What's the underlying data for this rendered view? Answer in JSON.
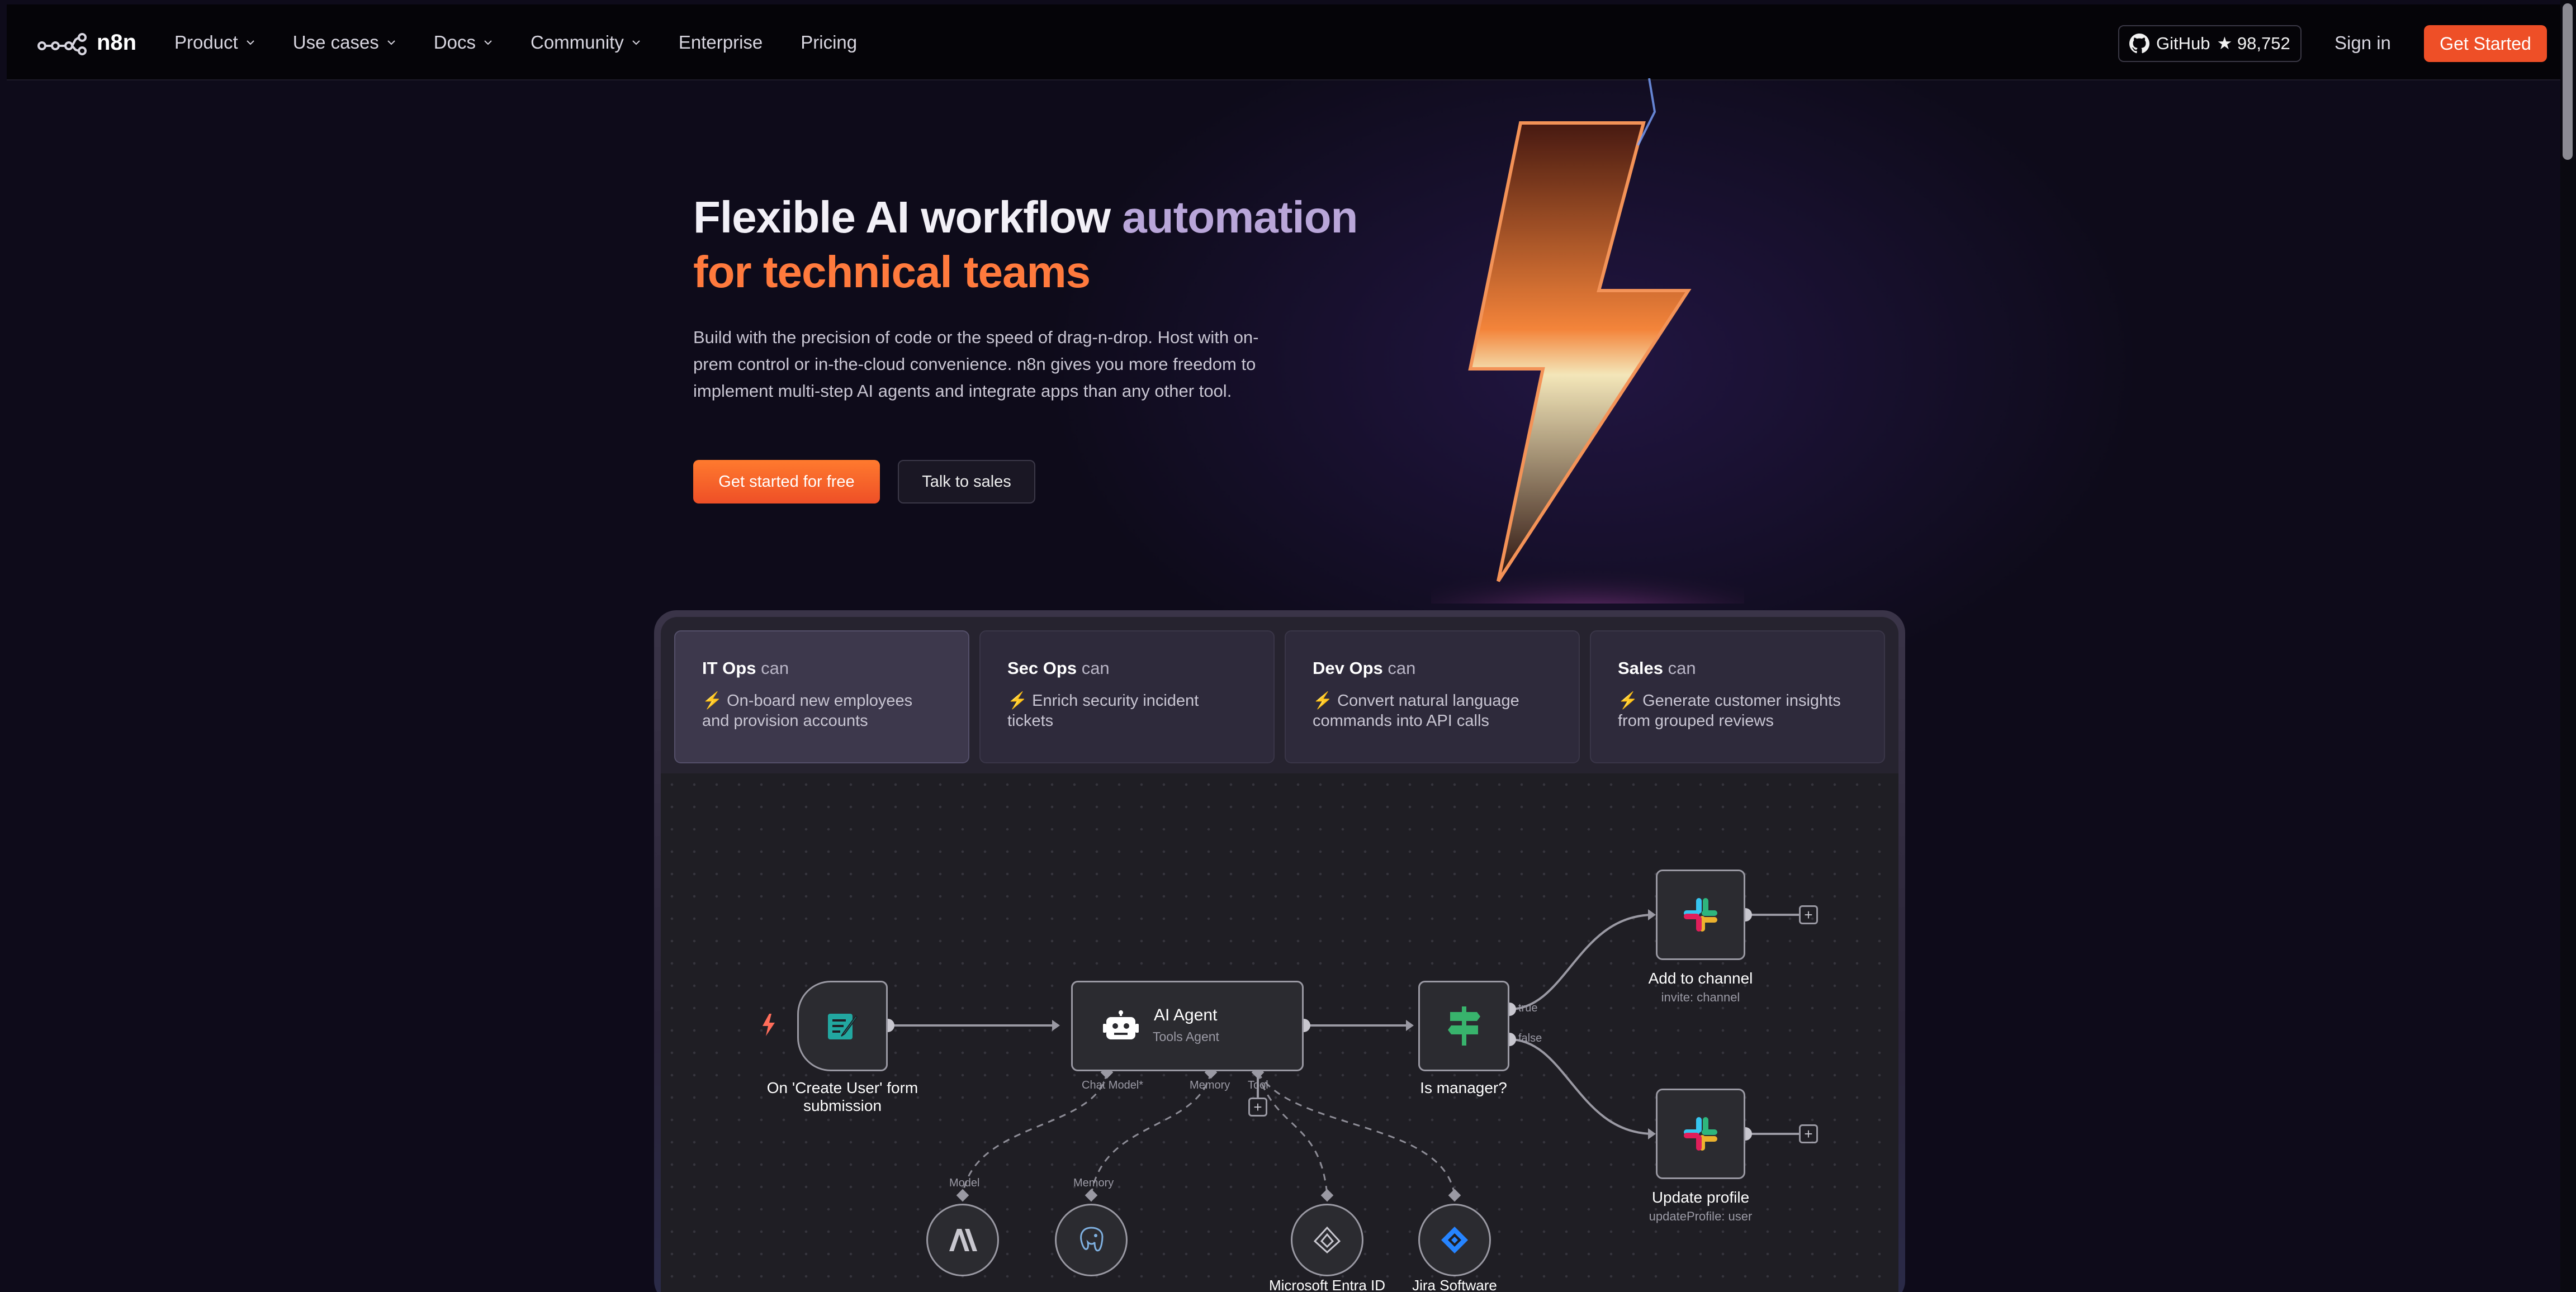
{
  "brand": {
    "name": "n8n",
    "accent": "#ee4f27"
  },
  "nav": {
    "items": [
      {
        "label": "Product",
        "dropdown": true
      },
      {
        "label": "Use cases",
        "dropdown": true
      },
      {
        "label": "Docs",
        "dropdown": true
      },
      {
        "label": "Community",
        "dropdown": true
      },
      {
        "label": "Enterprise",
        "dropdown": false
      },
      {
        "label": "Pricing",
        "dropdown": false
      }
    ],
    "github_label": "GitHub",
    "github_stars": "★ 98,752",
    "signin": "Sign in",
    "cta": "Get Started"
  },
  "hero": {
    "title_line1_a": "Flexible AI workflow",
    "title_line1_b": "automation",
    "title_line2": "for technical teams",
    "subtitle": "Build with the precision of code or the speed of drag-n-drop. Host with on-prem control or in-the-cloud convenience. n8n gives you more freedom to implement multi-step AI agents and integrate apps than any other tool.",
    "primary_button": "Get started for free",
    "secondary_button": "Talk to sales"
  },
  "tabs": [
    {
      "team": "IT Ops",
      "can": "can",
      "desc": "On-board new employees and provision accounts",
      "active": true
    },
    {
      "team": "Sec Ops",
      "can": "can",
      "desc": "Enrich security incident tickets",
      "active": false
    },
    {
      "team": "Dev Ops",
      "can": "can",
      "desc": "Convert natural language commands into API calls",
      "active": false
    },
    {
      "team": "Sales",
      "can": "can",
      "desc": "Generate customer insights from grouped reviews",
      "active": false
    }
  ],
  "workflow": {
    "trigger": {
      "label": "On 'Create User' form submission",
      "icon": "form-icon"
    },
    "agent": {
      "title": "AI Agent",
      "subtitle": "Tools Agent",
      "icon": "robot-icon",
      "ports": {
        "chat_model": "Chat Model*",
        "memory": "Memory",
        "tool": "Tool"
      }
    },
    "if_node": {
      "label": "Is manager?",
      "icon": "signpost-icon",
      "true_label": "true",
      "false_label": "false"
    },
    "slack_add": {
      "label": "Add to channel",
      "sub": "invite: channel",
      "icon": "slack-icon"
    },
    "slack_update": {
      "label": "Update profile",
      "sub": "updateProfile: user",
      "icon": "slack-icon"
    },
    "model": {
      "port_label": "Model",
      "icon": "anthropic-icon"
    },
    "memory": {
      "port_label": "Memory",
      "icon": "postgres-icon"
    },
    "entra": {
      "label": "Microsoft Entra ID",
      "icon": "entra-icon"
    },
    "jira": {
      "label": "Jira Software",
      "icon": "jira-icon"
    }
  }
}
